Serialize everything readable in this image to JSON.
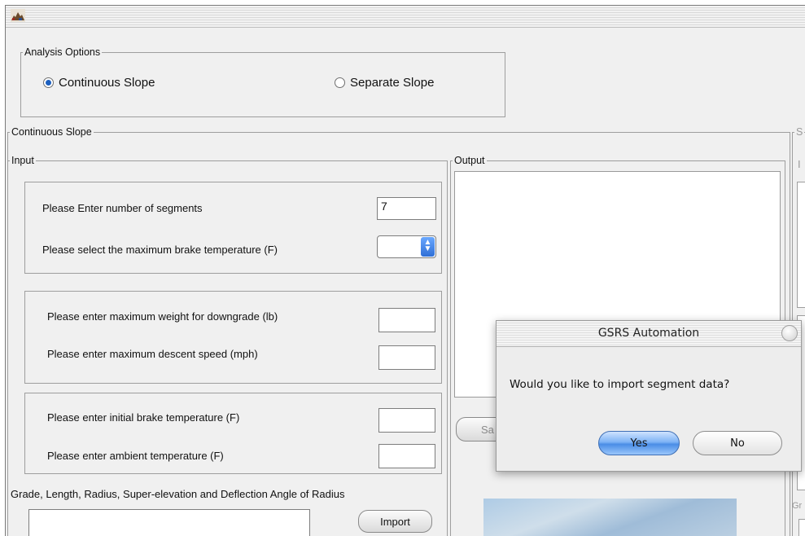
{
  "window": {
    "title": ""
  },
  "analysis_options": {
    "legend": "Analysis Options",
    "continuous_label": "Continuous Slope",
    "separate_label": "Separate Slope",
    "selected": "Continuous Slope"
  },
  "continuous": {
    "legend": "Continuous Slope",
    "input": {
      "legend": "Input",
      "segments_label": "Please Enter number of segments",
      "segments_value": "7",
      "max_brake_label": "Please select the maximum brake temperature (F)",
      "max_brake_value": "",
      "max_weight_label": "Please enter maximum weight for downgrade (lb)",
      "max_weight_value": "",
      "max_descent_label": "Please enter maximum descent speed (mph)",
      "max_descent_value": "",
      "initial_brake_label": "Please enter initial brake temperature (F)",
      "initial_brake_value": "",
      "ambient_label": "Please enter ambient temperature (F)",
      "ambient_value": "",
      "grade_label": "Grade, Length, Radius, Super-elevation and Deflection Angle of Radius",
      "grade_value": "",
      "import_label": "Import"
    },
    "output": {
      "legend": "Output",
      "save_label_fragment": "Sa"
    }
  },
  "right_panel": {
    "legend_fragment": "S",
    "input_fragment": "I",
    "gr_fragment": "Gr"
  },
  "dialog": {
    "title": "GSRS Automation",
    "message": "Would you like to import segment data?",
    "yes_label": "Yes",
    "no_label": "No"
  },
  "colors": {
    "window_bg": "#f0f0f0",
    "radio_selected": "#1c5fbf",
    "primary_button": "#4a8de6"
  }
}
